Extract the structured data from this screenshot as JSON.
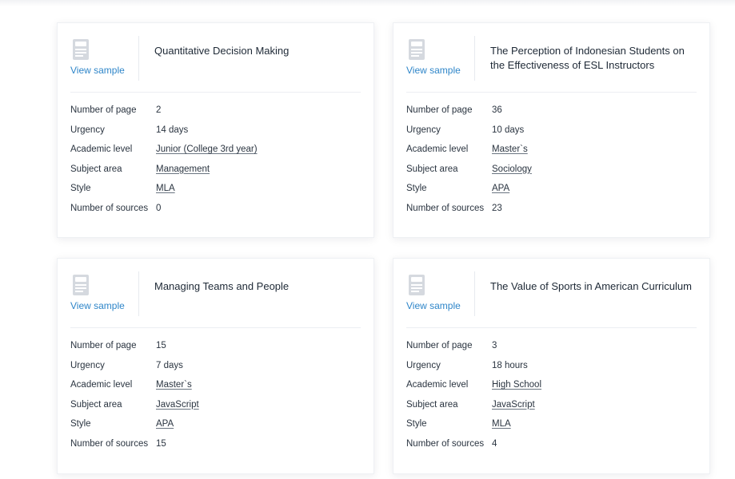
{
  "samples": [
    {
      "view_label": "View sample",
      "title": "Quantitative Decision Making",
      "rows": [
        {
          "label": "Number of page",
          "value": "2"
        },
        {
          "label": "Urgency",
          "value": "14 days"
        },
        {
          "label": "Academic level",
          "value": "Junior (College 3rd year)"
        },
        {
          "label": "Subject area",
          "value": "Management"
        },
        {
          "label": "Style",
          "value": "MLA"
        },
        {
          "label": "Number of sources",
          "value": "0"
        }
      ]
    },
    {
      "view_label": "View sample",
      "title": "The Perception of Indonesian Students on the Effectiveness of ESL Instructors",
      "rows": [
        {
          "label": "Number of page",
          "value": "36"
        },
        {
          "label": "Urgency",
          "value": "10 days"
        },
        {
          "label": "Academic level",
          "value": "Master`s"
        },
        {
          "label": "Subject area",
          "value": "Sociology"
        },
        {
          "label": "Style",
          "value": "APA"
        },
        {
          "label": "Number of sources",
          "value": "23"
        }
      ]
    },
    {
      "view_label": "View sample",
      "title": "Managing Teams and People",
      "rows": [
        {
          "label": "Number of page",
          "value": "15"
        },
        {
          "label": "Urgency",
          "value": "7 days"
        },
        {
          "label": "Academic level",
          "value": "Master`s"
        },
        {
          "label": "Subject area",
          "value": "JavaScript"
        },
        {
          "label": "Style",
          "value": "APA"
        },
        {
          "label": "Number of sources",
          "value": "15"
        }
      ]
    },
    {
      "view_label": "View sample",
      "title": "The Value of Sports in American Curriculum",
      "rows": [
        {
          "label": "Number of page",
          "value": "3"
        },
        {
          "label": "Urgency",
          "value": "18 hours"
        },
        {
          "label": "Academic level",
          "value": "High School"
        },
        {
          "label": "Subject area",
          "value": "JavaScript"
        },
        {
          "label": "Style",
          "value": "MLA"
        },
        {
          "label": "Number of sources",
          "value": "4"
        }
      ]
    }
  ],
  "icons": {
    "sample_icon": "pdf-document-icon"
  },
  "colors": {
    "link": "#2f86c9",
    "text": "#1e2936",
    "icon": "#d5d9df"
  }
}
